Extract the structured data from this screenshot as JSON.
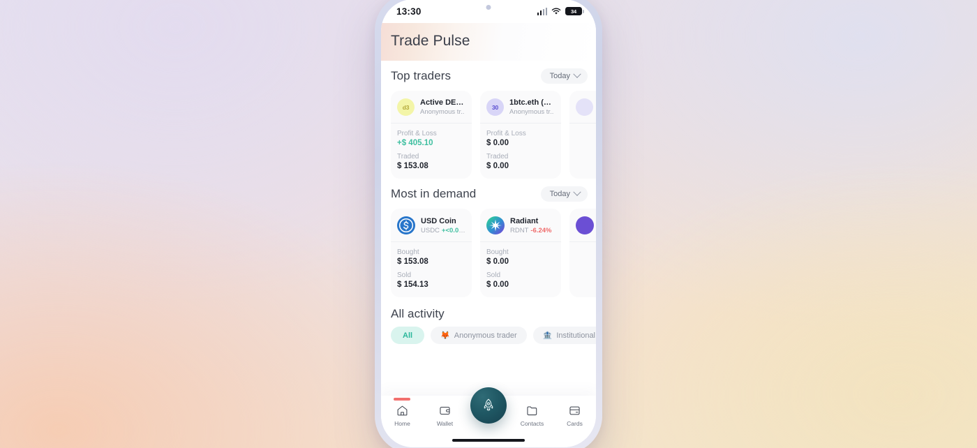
{
  "status_bar": {
    "time": "13:30",
    "battery_level": "34",
    "signal_icon": "cellular-signal-icon",
    "wifi_icon": "wifi-icon",
    "battery_icon": "battery-icon"
  },
  "header": {
    "title": "Trade Pulse"
  },
  "top_traders": {
    "title": "Top traders",
    "period": "Today",
    "cards": [
      {
        "avatar_text": "d3",
        "avatar_bg": "#f3f5a8",
        "avatar_color": "#b3a93a",
        "name": "Active DEX ...",
        "subtitle": "Anonymous tr..",
        "stat1_label": "Profit & Loss",
        "stat1_value": "+$ 405.10",
        "stat1_positive": true,
        "stat2_label": "Traded",
        "stat2_value": "$ 153.08"
      },
      {
        "avatar_text": "30",
        "avatar_bg": "#d8d5f7",
        "avatar_color": "#5b4fd1",
        "name": "1btc.eth (0x...",
        "subtitle": "Anonymous tr..",
        "stat1_label": "Profit & Loss",
        "stat1_value": "$ 0.00",
        "stat1_positive": false,
        "stat2_label": "Traded",
        "stat2_value": "$ 0.00"
      },
      {
        "avatar_text": "",
        "avatar_bg": "#e4e2f8",
        "avatar_color": "#5b4fd1",
        "name": "",
        "subtitle": "",
        "stat1_label": "",
        "stat1_value": "",
        "stat1_positive": false,
        "stat2_label": "",
        "stat2_value": ""
      }
    ]
  },
  "most_in_demand": {
    "title": "Most in demand",
    "period": "Today",
    "cards": [
      {
        "icon_name": "usd-coin-icon",
        "name": "USD Coin",
        "ticker": "USDC",
        "change": "+<0.01%",
        "change_positive": true,
        "stat1_label": "Bought",
        "stat1_value": "$ 153.08",
        "stat2_label": "Sold",
        "stat2_value": "$ 154.13"
      },
      {
        "icon_name": "radiant-icon",
        "name": "Radiant",
        "ticker": "RDNT",
        "change": "-6.24%",
        "change_positive": false,
        "stat1_label": "Bought",
        "stat1_value": "$ 0.00",
        "stat2_label": "Sold",
        "stat2_value": "$ 0.00"
      },
      {
        "icon_name": "coin-icon",
        "name": "",
        "ticker": "",
        "change": "",
        "change_positive": true,
        "stat1_label": "",
        "stat1_value": "",
        "stat2_label": "",
        "stat2_value": ""
      }
    ]
  },
  "all_activity": {
    "title": "All activity",
    "filters": [
      {
        "label": "All",
        "emoji": "",
        "active": true
      },
      {
        "label": "Anonymous trader",
        "emoji": "🦊",
        "active": false
      },
      {
        "label": "Institutional",
        "emoji": "🏦",
        "active": false
      }
    ]
  },
  "bottom_nav": {
    "items": [
      {
        "label": "Home",
        "icon": "home-icon",
        "active": true
      },
      {
        "label": "Wallet",
        "icon": "wallet-icon",
        "active": false
      },
      {
        "label": "Contacts",
        "icon": "contacts-folder-icon",
        "active": false
      },
      {
        "label": "Cards",
        "icon": "cards-icon",
        "active": false
      }
    ],
    "fab_icon": "rocket-icon"
  },
  "colors": {
    "accent_teal": "#2bb79b",
    "positive": "#3fbfa0",
    "negative": "#ef6b6b",
    "nav_indicator": "#f2706e",
    "fab": "#1f5763"
  }
}
